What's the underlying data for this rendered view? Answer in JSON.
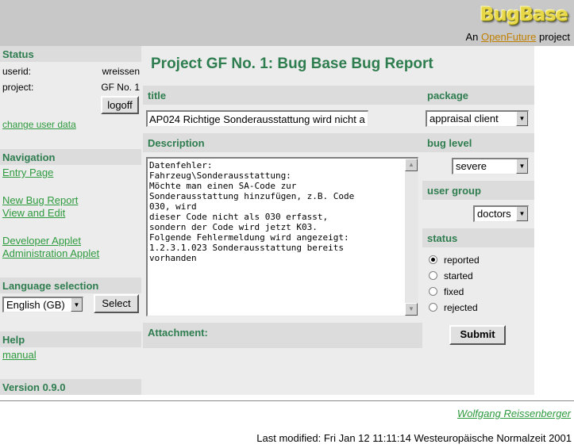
{
  "header": {
    "logo": "BugBase",
    "tagline_prefix": "An",
    "tagline_link": "OpenFuture",
    "tagline_suffix": "project"
  },
  "sidebar": {
    "status_title": "Status",
    "userid_label": "userid:",
    "userid_value": "wreissen",
    "project_label": "project:",
    "project_value": "GF No. 1",
    "logoff_label": "logoff",
    "change_user_data": "change user data",
    "navigation_title": "Navigation",
    "nav": {
      "entry_page": "Entry Page",
      "new_bug_report": "New Bug Report",
      "view_and_edit": "View and Edit",
      "developer_applet": "Developer Applet",
      "administration_applet": "Administration Applet"
    },
    "language_title": "Language selection",
    "language_selected": "English (GB)",
    "select_label": "Select",
    "help_title": "Help",
    "manual": "manual",
    "version": "Version 0.9.0"
  },
  "main": {
    "page_title": "Project GF No. 1: Bug Base Bug Report",
    "title_label": "title",
    "title_value": "AP024 Richtige Sonderausstattung wird nicht a",
    "package_label": "package",
    "package_value": "appraisal client",
    "description_label": "Description",
    "description_text": "Datenfehler:\nFahrzeug\\Sonderausstattung:\nMöchte man einen SA-Code zur\nSonderausstattung hinzufügen, z.B. Code\n030, wird\ndieser Code nicht als 030 erfasst,\nsondern der Code wird jetzt K03.\nFolgende Fehlermeldung wird angezeigt:\n1.2.3.1.023 Sonderausstattung bereits\nvorhanden",
    "bug_level_label": "bug level",
    "bug_level_value": "severe",
    "user_group_label": "user group",
    "user_group_value": "doctors",
    "status_label": "status",
    "status_options": [
      "reported",
      "started",
      "fixed",
      "rejected"
    ],
    "status_selected": "reported",
    "attachment_label": "Attachment:",
    "submit_label": "Submit"
  },
  "footer": {
    "author": "Wolfgang Reissenberger",
    "last_modified": "Last modified: Fri Jan 12 11:11:14 Westeuropäische Normalzeit 2001"
  },
  "colors": {
    "heading_green": "#2e7d4f",
    "link_green": "#2e9a3e",
    "header_gray": "#c8c8c8",
    "panel_gray": "#ececec"
  }
}
